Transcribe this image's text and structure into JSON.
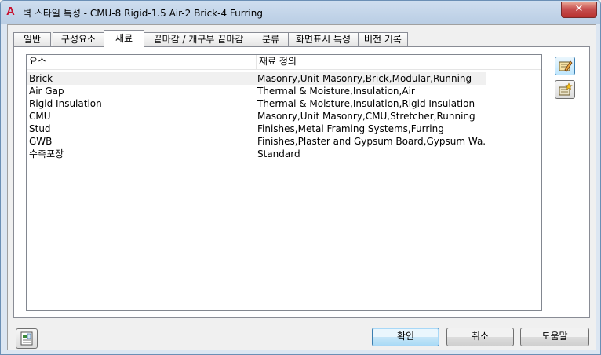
{
  "window": {
    "title": "벽 스타일 특성 - CMU-8 Rigid-1.5 Air-2 Brick-4 Furring",
    "close_label": "✕"
  },
  "tabs": [
    {
      "label": "일반",
      "active": false
    },
    {
      "label": "구성요소",
      "active": false
    },
    {
      "label": "재료",
      "active": true
    },
    {
      "label": "끝마감 / 개구부 끝마감",
      "active": false
    },
    {
      "label": "분류",
      "active": false
    },
    {
      "label": "화면표시 특성",
      "active": false
    },
    {
      "label": "버전 기록",
      "active": false
    }
  ],
  "table": {
    "columns": [
      "요소",
      "재료 정의"
    ],
    "rows": [
      {
        "component": "Brick",
        "material": "Masonry,Unit Masonry,Brick,Modular,Running",
        "selected": true
      },
      {
        "component": "Air Gap",
        "material": "Thermal & Moisture,Insulation,Air",
        "selected": false
      },
      {
        "component": "Rigid Insulation",
        "material": "Thermal & Moisture,Insulation,Rigid Insulation",
        "selected": false
      },
      {
        "component": "CMU",
        "material": "Masonry,Unit Masonry,CMU,Stretcher,Running",
        "selected": false
      },
      {
        "component": "Stud",
        "material": "Finishes,Metal Framing Systems,Furring",
        "selected": false
      },
      {
        "component": "GWB",
        "material": "Finishes,Plaster and Gypsum Board,Gypsum Wa...",
        "selected": false
      },
      {
        "component": "수축포장",
        "material": "Standard",
        "selected": false
      }
    ]
  },
  "side_buttons": [
    {
      "icon": "edit-material-icon"
    },
    {
      "icon": "new-material-icon"
    }
  ],
  "footer": {
    "style_manager_icon": "style-manager-icon",
    "ok_label": "확인",
    "cancel_label": "취소",
    "help_label": "도움말"
  },
  "colors": {
    "selection_bg": "#f0f0f0",
    "accent_border": "#3c7fb1",
    "close_red": "#c75050"
  }
}
